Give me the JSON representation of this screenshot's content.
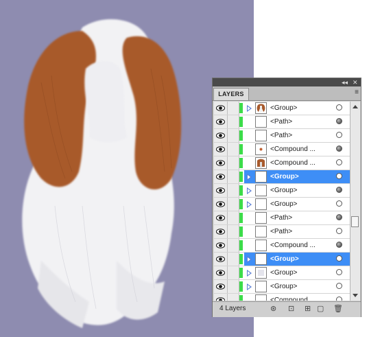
{
  "panel": {
    "title_controls": {
      "collapse": "◂◂",
      "close": "✕"
    },
    "tab_label": "LAYERS",
    "menu_icon": "≡",
    "layer_count": "4 Layers",
    "bottom_icons": [
      "locate-object-icon",
      "make-clipping-mask-icon",
      "new-sublayer-icon",
      "new-layer-icon",
      "delete-icon"
    ]
  },
  "layers": [
    {
      "label": "<Group>",
      "expand": true,
      "thumb": "dog-ear",
      "selected": false,
      "target_filled": false
    },
    {
      "label": "<Path>",
      "expand": false,
      "thumb": "blank",
      "selected": false,
      "target_filled": true
    },
    {
      "label": "<Path>",
      "expand": false,
      "thumb": "blank",
      "selected": false,
      "target_filled": false
    },
    {
      "label": "<Compound ...",
      "expand": false,
      "thumb": "dot",
      "selected": false,
      "target_filled": true
    },
    {
      "label": "<Compound ...",
      "expand": false,
      "thumb": "brown",
      "selected": false,
      "target_filled": false
    },
    {
      "label": "<Group>",
      "expand": true,
      "thumb": "blank",
      "selected": true,
      "target_filled": false
    },
    {
      "label": "<Group>",
      "expand": true,
      "thumb": "blank",
      "selected": false,
      "target_filled": true
    },
    {
      "label": "<Group>",
      "expand": true,
      "thumb": "blank",
      "selected": false,
      "target_filled": false
    },
    {
      "label": "<Path>",
      "expand": false,
      "thumb": "blank",
      "selected": false,
      "target_filled": true
    },
    {
      "label": "<Path>",
      "expand": false,
      "thumb": "blank",
      "selected": false,
      "target_filled": false
    },
    {
      "label": "<Compound ...",
      "expand": false,
      "thumb": "blank",
      "selected": false,
      "target_filled": true
    },
    {
      "label": "<Group>",
      "expand": true,
      "thumb": "blank",
      "selected": true,
      "target_filled": false
    },
    {
      "label": "<Group>",
      "expand": true,
      "thumb": "faint",
      "selected": false,
      "target_filled": false
    },
    {
      "label": "<Group>",
      "expand": true,
      "thumb": "blank",
      "selected": false,
      "target_filled": false
    },
    {
      "label": "<Compound ...",
      "expand": false,
      "thumb": "blank",
      "selected": false,
      "target_filled": false
    }
  ],
  "colors": {
    "canvas_bg": "#8e8cb0",
    "fur_brown": "#a85a2c",
    "fur_white": "#f2f2f4",
    "selection": "#3e8ef6",
    "layer_color": "#3ddc4a"
  }
}
